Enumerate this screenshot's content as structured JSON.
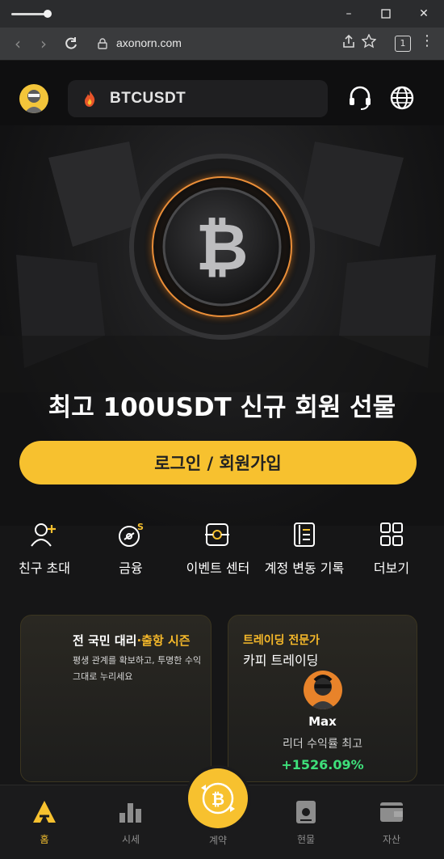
{
  "browser": {
    "url": "axonorn.com",
    "tab_count": "1"
  },
  "header": {
    "ticker": "BTCUSDT"
  },
  "hero": {
    "title": "최고 100USDT 신규 회원 선물",
    "login_button": "로그인 / 회원가입"
  },
  "menu": [
    {
      "label": "친구 초대",
      "icon": "add-friend-icon"
    },
    {
      "label": "금융",
      "icon": "finance-icon"
    },
    {
      "label": "이벤트 센터",
      "icon": "event-center-icon"
    },
    {
      "label": "계정 변동 기록",
      "icon": "account-record-icon"
    },
    {
      "label": "더보기",
      "icon": "more-grid-icon"
    }
  ],
  "promo_card": {
    "title_a": "전 국민 대리",
    "title_b": "·출항 시즌",
    "desc_line1": "평생 관계를 확보하고, 투명한 수익",
    "desc_line2": "그대로 누리세요"
  },
  "copy_card": {
    "tag": "트레이딩 전문가",
    "title": "카피 트레이딩",
    "trader_name": "Max",
    "metric_label": "리더 수익률 최고",
    "metric_value": "+1526.09%"
  },
  "bottom_nav": {
    "home": "홈",
    "market": "시세",
    "contract": "계약",
    "spot": "현물",
    "assets": "자산"
  },
  "colors": {
    "accent": "#f7c12f",
    "positive": "#3ee07a",
    "background": "#161617"
  }
}
